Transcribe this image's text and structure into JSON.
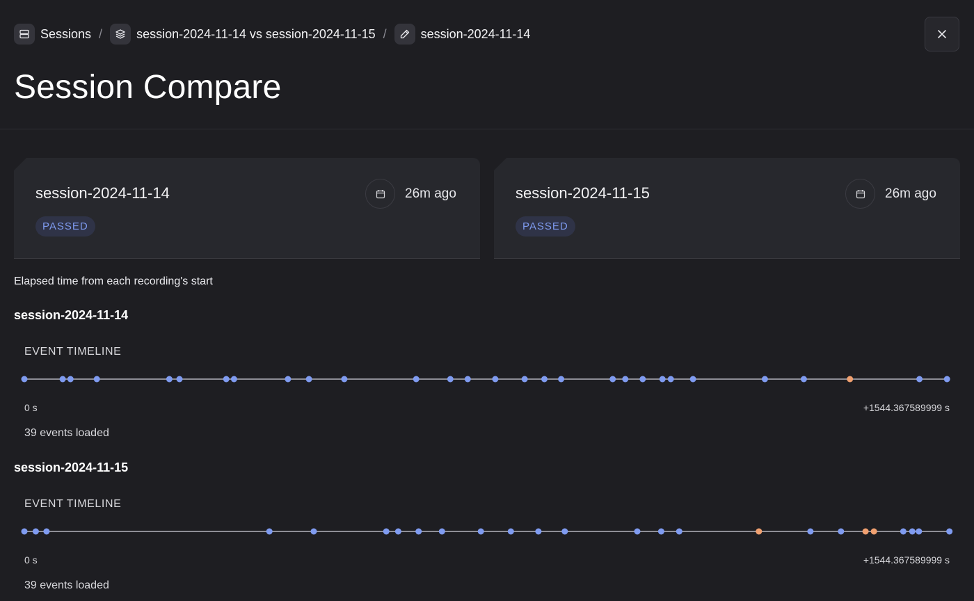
{
  "breadcrumb": {
    "items": [
      {
        "label": "Sessions",
        "icon": "server-stack-icon"
      },
      {
        "label": "session-2024-11-14 vs session-2024-11-15",
        "icon": "layers-icon"
      },
      {
        "label": "session-2024-11-14",
        "icon": "pencil-icon"
      }
    ],
    "separator": "/"
  },
  "close_icon": "close-icon",
  "page_title": "Session Compare",
  "cards": [
    {
      "name": "session-2024-11-14",
      "status": "PASSED",
      "time": "26m ago",
      "icon": "calendar-icon"
    },
    {
      "name": "session-2024-11-15",
      "status": "PASSED",
      "time": "26m ago",
      "icon": "calendar-icon"
    }
  ],
  "elapsed_caption": "Elapsed time from each recording's start",
  "timelines": [
    {
      "session": "session-2024-11-14",
      "label": "EVENT TIMELINE",
      "start_label": "0 s",
      "end_label": "+1544.367589999 s",
      "count_label": "39 events loaded",
      "duration_s": 1544.367589999,
      "events": [
        {
          "t": 0,
          "kind": "normal"
        },
        {
          "t": 64,
          "kind": "normal"
        },
        {
          "t": 77,
          "kind": "normal"
        },
        {
          "t": 121,
          "kind": "normal"
        },
        {
          "t": 242,
          "kind": "normal"
        },
        {
          "t": 259,
          "kind": "normal"
        },
        {
          "t": 337,
          "kind": "normal"
        },
        {
          "t": 350,
          "kind": "normal"
        },
        {
          "t": 440,
          "kind": "normal"
        },
        {
          "t": 475,
          "kind": "normal"
        },
        {
          "t": 534,
          "kind": "normal"
        },
        {
          "t": 654,
          "kind": "normal"
        },
        {
          "t": 711,
          "kind": "normal"
        },
        {
          "t": 740,
          "kind": "normal"
        },
        {
          "t": 786,
          "kind": "normal"
        },
        {
          "t": 835,
          "kind": "normal"
        },
        {
          "t": 868,
          "kind": "normal"
        },
        {
          "t": 896,
          "kind": "normal"
        },
        {
          "t": 982,
          "kind": "normal"
        },
        {
          "t": 1003,
          "kind": "normal"
        },
        {
          "t": 1032,
          "kind": "normal"
        },
        {
          "t": 1065,
          "kind": "normal"
        },
        {
          "t": 1079,
          "kind": "normal"
        },
        {
          "t": 1116,
          "kind": "normal"
        },
        {
          "t": 1236,
          "kind": "normal"
        },
        {
          "t": 1301,
          "kind": "normal"
        },
        {
          "t": 1378,
          "kind": "warning"
        },
        {
          "t": 1494,
          "kind": "normal"
        },
        {
          "t": 1540,
          "kind": "normal"
        }
      ]
    },
    {
      "session": "session-2024-11-15",
      "label": "EVENT TIMELINE",
      "start_label": "0 s",
      "end_label": "+1544.367589999 s",
      "count_label": "39 events loaded",
      "duration_s": 1544.367589999,
      "events": [
        {
          "t": 0,
          "kind": "normal"
        },
        {
          "t": 19,
          "kind": "normal"
        },
        {
          "t": 37,
          "kind": "normal"
        },
        {
          "t": 409,
          "kind": "normal"
        },
        {
          "t": 483,
          "kind": "normal"
        },
        {
          "t": 604,
          "kind": "normal"
        },
        {
          "t": 624,
          "kind": "normal"
        },
        {
          "t": 658,
          "kind": "normal"
        },
        {
          "t": 697,
          "kind": "normal"
        },
        {
          "t": 762,
          "kind": "normal"
        },
        {
          "t": 812,
          "kind": "normal"
        },
        {
          "t": 858,
          "kind": "normal"
        },
        {
          "t": 902,
          "kind": "normal"
        },
        {
          "t": 1023,
          "kind": "normal"
        },
        {
          "t": 1063,
          "kind": "normal"
        },
        {
          "t": 1093,
          "kind": "normal"
        },
        {
          "t": 1226,
          "kind": "warning"
        },
        {
          "t": 1312,
          "kind": "normal"
        },
        {
          "t": 1363,
          "kind": "normal"
        },
        {
          "t": 1404,
          "kind": "warning"
        },
        {
          "t": 1418,
          "kind": "warning"
        },
        {
          "t": 1467,
          "kind": "normal"
        },
        {
          "t": 1482,
          "kind": "normal"
        },
        {
          "t": 1493,
          "kind": "normal"
        },
        {
          "t": 1544,
          "kind": "normal"
        }
      ]
    }
  ],
  "colors": {
    "normal": "#7f9bf0",
    "warning": "#f0a070",
    "track": "#8e8e96",
    "badge_text": "#7f9bf0"
  }
}
